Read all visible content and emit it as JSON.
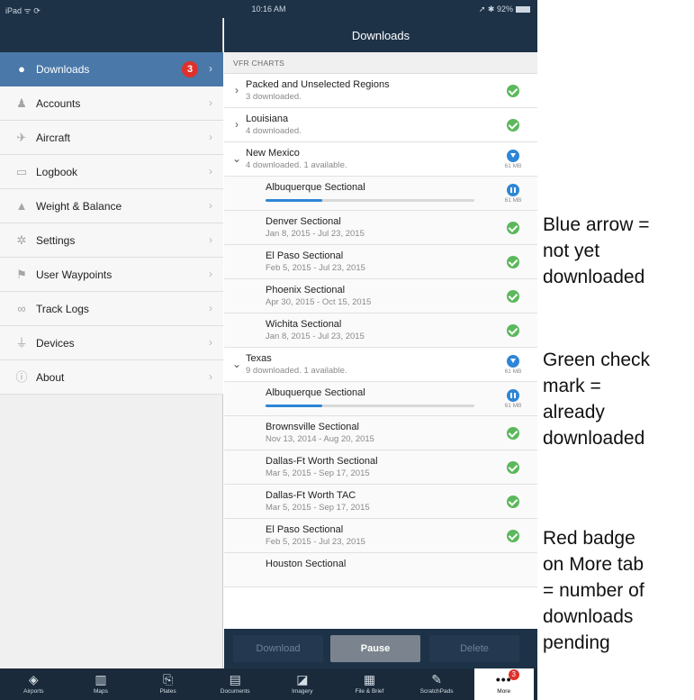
{
  "status_bar": {
    "left": "iPad ᯤ ⟳",
    "time": "10:16 AM",
    "right": "➚ ✱ 92%"
  },
  "header": {
    "title": "Downloads"
  },
  "sidebar": {
    "items": [
      {
        "label": "Downloads",
        "icon": "download-circle-icon",
        "glyph": "●",
        "active": true,
        "badge": "3"
      },
      {
        "label": "Accounts",
        "icon": "person-icon",
        "glyph": "♟"
      },
      {
        "label": "Aircraft",
        "icon": "airplane-icon",
        "glyph": "✈"
      },
      {
        "label": "Logbook",
        "icon": "book-icon",
        "glyph": "▭"
      },
      {
        "label": "Weight & Balance",
        "icon": "scale-icon",
        "glyph": "▲"
      },
      {
        "label": "Settings",
        "icon": "gear-icon",
        "glyph": "✲"
      },
      {
        "label": "User Waypoints",
        "icon": "flag-icon",
        "glyph": "⚑"
      },
      {
        "label": "Track Logs",
        "icon": "track-icon",
        "glyph": "∞"
      },
      {
        "label": "Devices",
        "icon": "plug-icon",
        "glyph": "⏚"
      },
      {
        "label": "About",
        "icon": "info-icon",
        "glyph": "ⓘ"
      }
    ]
  },
  "section": {
    "label": "VFR CHARTS"
  },
  "rows": [
    {
      "kind": "region",
      "disclosure": "›",
      "title": "Packed and Unselected Regions",
      "sub": "3 downloaded.",
      "status": "check"
    },
    {
      "kind": "region",
      "disclosure": "›",
      "title": "Louisiana",
      "sub": "4 downloaded.",
      "status": "check"
    },
    {
      "kind": "region",
      "disclosure": "⌄",
      "title": "New Mexico",
      "sub": "4 downloaded. 1 available.",
      "status": "download",
      "size": "61 MB"
    },
    {
      "kind": "child",
      "title": "Albuquerque Sectional",
      "sub": "",
      "status": "pause",
      "size": "61 MB",
      "progress": 0.27
    },
    {
      "kind": "child",
      "title": "Denver Sectional",
      "sub": "Jan 8, 2015 - Jul 23, 2015",
      "status": "check"
    },
    {
      "kind": "child",
      "title": "El Paso Sectional",
      "sub": "Feb 5, 2015 - Jul 23, 2015",
      "status": "check"
    },
    {
      "kind": "child",
      "title": "Phoenix Sectional",
      "sub": "Apr 30, 2015 - Oct 15, 2015",
      "status": "check"
    },
    {
      "kind": "child",
      "title": "Wichita Sectional",
      "sub": "Jan 8, 2015 - Jul 23, 2015",
      "status": "check"
    },
    {
      "kind": "region",
      "disclosure": "⌄",
      "title": "Texas",
      "sub": "9 downloaded. 1 available.",
      "status": "download",
      "size": "61 MB"
    },
    {
      "kind": "child",
      "title": "Albuquerque Sectional",
      "sub": "",
      "status": "pause",
      "size": "61 MB",
      "progress": 0.27
    },
    {
      "kind": "child",
      "title": "Brownsville Sectional",
      "sub": "Nov 13, 2014 - Aug 20, 2015",
      "status": "check"
    },
    {
      "kind": "child",
      "title": "Dallas-Ft Worth Sectional",
      "sub": "Mar 5, 2015 - Sep 17, 2015",
      "status": "check"
    },
    {
      "kind": "child",
      "title": "Dallas-Ft Worth TAC",
      "sub": "Mar 5, 2015 - Sep 17, 2015",
      "status": "check"
    },
    {
      "kind": "child",
      "title": "El Paso Sectional",
      "sub": "Feb 5, 2015 - Jul 23, 2015",
      "status": "check"
    },
    {
      "kind": "child",
      "title": "Houston Sectional",
      "sub": "",
      "status": "none"
    }
  ],
  "actions": {
    "download": "Download",
    "pause": "Pause",
    "delete": "Delete"
  },
  "tabs": [
    {
      "label": "Airports",
      "icon": "airport-icon",
      "glyph": "◈"
    },
    {
      "label": "Maps",
      "icon": "map-icon",
      "glyph": "▥"
    },
    {
      "label": "Plates",
      "icon": "plates-icon",
      "glyph": "⎘"
    },
    {
      "label": "Documents",
      "icon": "documents-icon",
      "glyph": "▤"
    },
    {
      "label": "Imagery",
      "icon": "imagery-icon",
      "glyph": "◪"
    },
    {
      "label": "File & Brief",
      "icon": "file-brief-icon",
      "glyph": "▦"
    },
    {
      "label": "ScratchPads",
      "icon": "scratchpad-icon",
      "glyph": "✎"
    },
    {
      "label": "More",
      "icon": "more-icon",
      "glyph": "•••",
      "badge": "3",
      "selected": true
    }
  ],
  "notes": [
    {
      "lines": [
        "Blue arrow =",
        "not yet",
        "downloaded"
      ]
    },
    {
      "lines": [
        "Green check",
        "mark =",
        "already",
        "downloaded"
      ]
    },
    {
      "lines": [
        "Red badge",
        "on More tab",
        "= number of",
        "downloads",
        "pending"
      ]
    }
  ]
}
